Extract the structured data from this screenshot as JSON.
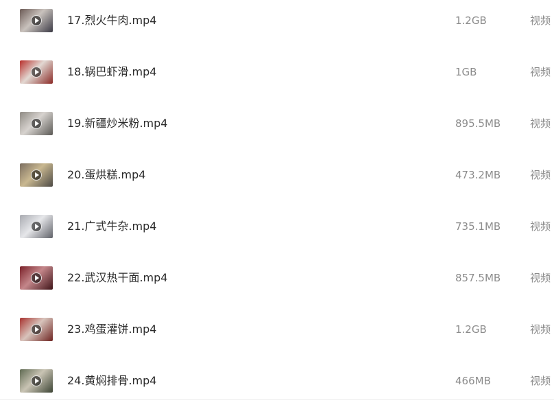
{
  "files": [
    {
      "name": "17.烈火牛肉.mp4",
      "size": "1.2GB",
      "type": "视频",
      "thumb_colors": [
        "#6b5a55",
        "#c9c2bd",
        "#3b3a45"
      ]
    },
    {
      "name": "18.锅巴虾滑.mp4",
      "size": "1GB",
      "type": "视频",
      "thumb_colors": [
        "#b8302c",
        "#e2d8d2",
        "#8a2a26"
      ]
    },
    {
      "name": "19.新疆炒米粉.mp4",
      "size": "895.5MB",
      "type": "视频",
      "thumb_colors": [
        "#8f8a84",
        "#d7d3cf",
        "#5b5955"
      ]
    },
    {
      "name": "20.蛋烘糕.mp4",
      "size": "473.2MB",
      "type": "视频",
      "thumb_colors": [
        "#7b6e60",
        "#c9b890",
        "#4d4a45"
      ]
    },
    {
      "name": "21.广式牛杂.mp4",
      "size": "735.1MB",
      "type": "视频",
      "thumb_colors": [
        "#a8aab0",
        "#e6e7ea",
        "#5f6168"
      ]
    },
    {
      "name": "22.武汉热干面.mp4",
      "size": "857.5MB",
      "type": "视频",
      "thumb_colors": [
        "#7a2028",
        "#c4868a",
        "#3e1418"
      ]
    },
    {
      "name": "23.鸡蛋灌饼.mp4",
      "size": "1.2GB",
      "type": "视频",
      "thumb_colors": [
        "#a8332f",
        "#d8c4bc",
        "#6e2421"
      ]
    },
    {
      "name": "24.黄焖排骨.mp4",
      "size": "466MB",
      "type": "视频",
      "thumb_colors": [
        "#5f6a52",
        "#c9c4b4",
        "#3c4434"
      ]
    }
  ]
}
